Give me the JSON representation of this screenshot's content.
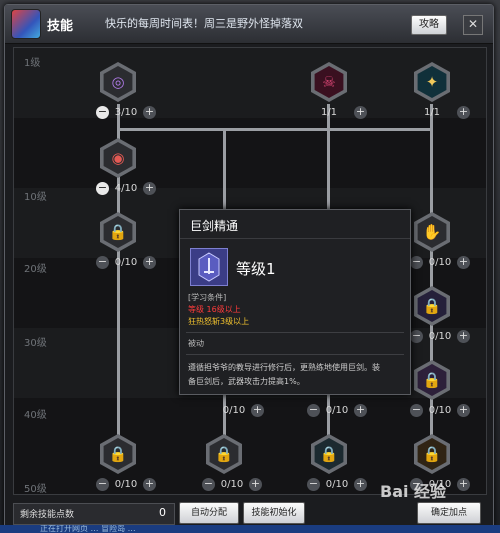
{
  "window": {
    "title": "技能",
    "ticker": "快乐的每周时间表！周三是野外怪掉落双",
    "guide_label": "攻略",
    "close_glyph": "✕"
  },
  "levels": [
    "1级",
    "10级",
    "20级",
    "30级",
    "40级",
    "50级"
  ],
  "skills": [
    {
      "id": "r1c1",
      "count": "3/10",
      "glyph": "◎",
      "color": "#9a63d6",
      "locked": false
    },
    {
      "id": "r1c4",
      "count": "1/1",
      "glyph": "☠",
      "color": "#c0305e",
      "locked": false
    },
    {
      "id": "r1c5",
      "count": "1/1",
      "glyph": "✦",
      "color": "#e0b94a",
      "locked": false
    },
    {
      "id": "r2c1",
      "count": "4/10",
      "glyph": "◉",
      "color": "#d4504a",
      "locked": false
    },
    {
      "id": "r3c1",
      "count": "0/10",
      "glyph": "🔒",
      "color": "#888",
      "locked": true
    },
    {
      "id": "r3c5",
      "count": "0/10",
      "glyph": "✋",
      "color": "#c8d4ff",
      "locked": false
    },
    {
      "id": "r4c5",
      "count": "0/10",
      "glyph": "🔒",
      "color": "#7b5ab5",
      "locked": true
    },
    {
      "id": "r5c5",
      "count": "0/10",
      "glyph": "🔒",
      "color": "#9b63c8",
      "locked": true
    },
    {
      "id": "r5c2",
      "count": "0/10",
      "glyph": "",
      "color": "#888",
      "locked": true
    },
    {
      "id": "r5c3",
      "count": "0/10",
      "glyph": "",
      "color": "#888",
      "locked": true
    },
    {
      "id": "r6c1",
      "count": "0/10",
      "glyph": "🔒",
      "color": "#888",
      "locked": true
    },
    {
      "id": "r6c3",
      "count": "0/10",
      "glyph": "🔒",
      "color": "#888",
      "locked": true
    },
    {
      "id": "r6c4",
      "count": "0/10",
      "glyph": "🔒",
      "color": "#6a9ab0",
      "locked": true
    },
    {
      "id": "r6c5",
      "count": "0/10",
      "glyph": "🔒",
      "color": "#c08a3a",
      "locked": true
    }
  ],
  "tooltip": {
    "name": "巨剑精通",
    "level_label": "等级1",
    "req_header": "[学习条件]",
    "req_level": "等级 16级以上",
    "req_skill": "狂热怒斩3级以上",
    "type": "被动",
    "desc_1": "遵循担爷爷的教导进行修行后，更熟练地使用巨剑。装",
    "desc_2": "备巨剑后，武器攻击力提高1%。",
    "colors": {
      "req_level": "#ff3b3b",
      "req_skill": "#f2c22e"
    }
  },
  "footer": {
    "remaining_label": "剩余技能点数",
    "remaining_value": "0",
    "auto_assign": "自动分配",
    "reset": "技能初始化",
    "confirm": "确定加点"
  },
  "watermark": "Bai 经验",
  "taskbar_text": "正在打开网页 … 冒险岛 …"
}
